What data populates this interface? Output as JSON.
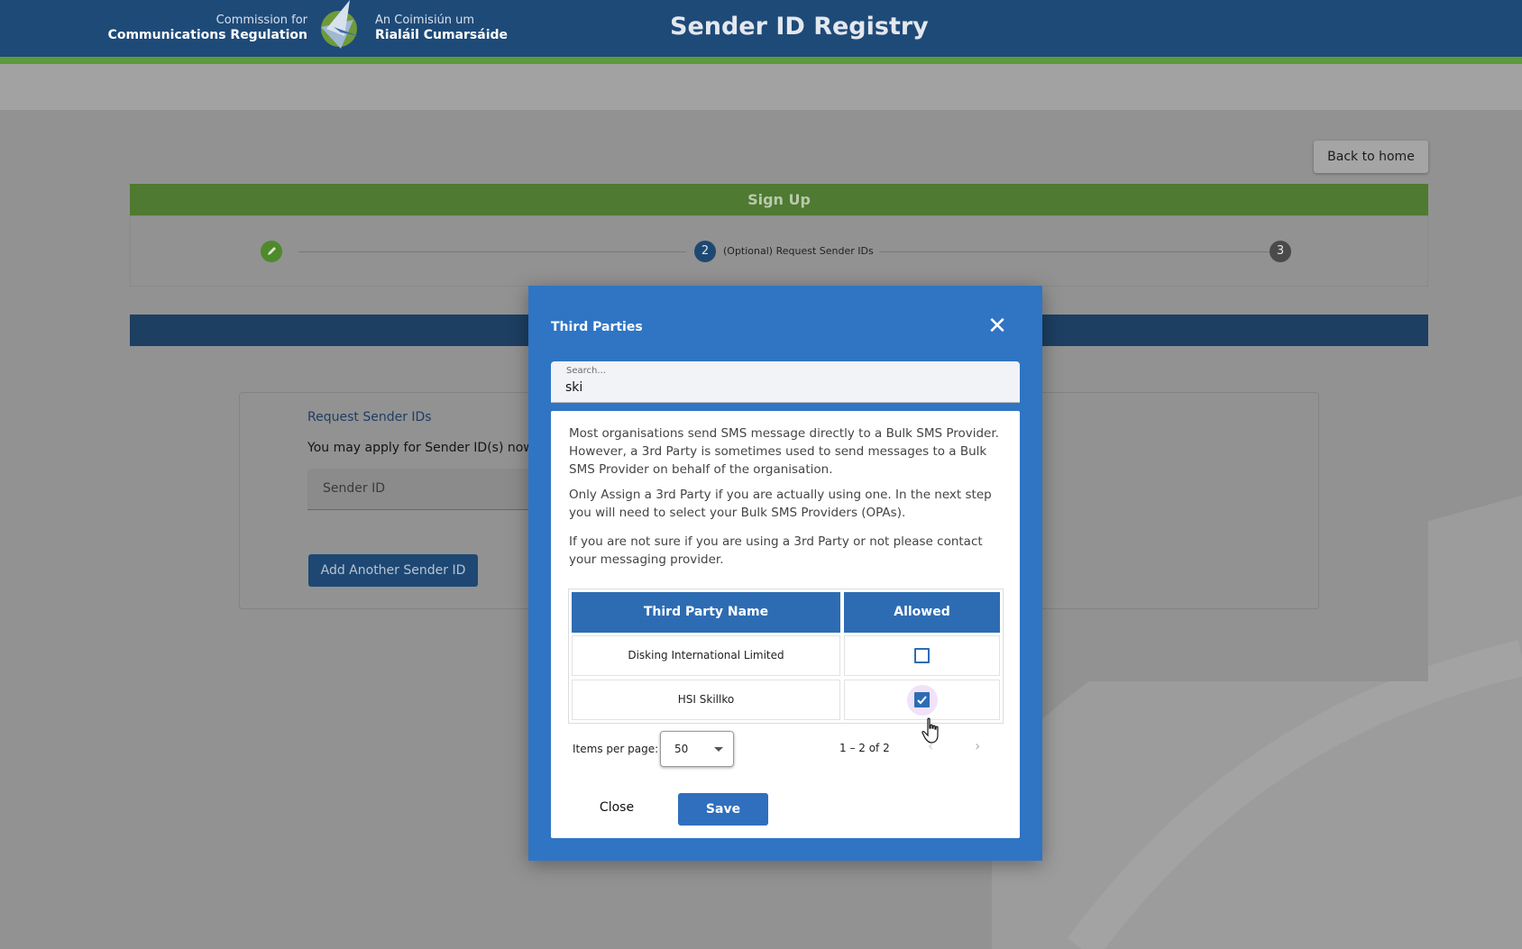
{
  "header": {
    "logo_left_line1": "Commission for",
    "logo_left_line2": "Communications Regulation",
    "logo_right_line1": "An Coimisiún um",
    "logo_right_line2": "Rialáil Cumarsáide",
    "app_title": "Sender ID Registry"
  },
  "page": {
    "back_button": "Back to home",
    "signup_title": "Sign Up",
    "steps": [
      {
        "number": "",
        "label": "",
        "state": "done"
      },
      {
        "number": "2",
        "label": "(Optional) Request Sender IDs",
        "state": "active"
      },
      {
        "number": "3",
        "label": "",
        "state": "pending"
      }
    ],
    "request_title": "Request Sender IDs",
    "request_text": "You may apply for Sender ID(s) now o",
    "sender_id_placeholder": "Sender ID",
    "add_button": "Add Another Sender ID"
  },
  "modal": {
    "title": "Third Parties",
    "close_icon": "close-icon",
    "search": {
      "label": "Search...",
      "value": "ski"
    },
    "paragraphs": [
      "Most organisations send SMS message directly to a Bulk SMS Provider. However, a 3rd Party is sometimes used to send messages to a Bulk SMS Provider on behalf of the organisation.",
      "Only Assign a 3rd Party if you are actually using one. In the next step you will need to select your Bulk SMS Providers (OPAs).",
      "If you are not sure if you are using a 3rd Party or not please contact your messaging provider."
    ],
    "table": {
      "headers": [
        "Third Party Name",
        "Allowed"
      ],
      "rows": [
        {
          "name": "Disking International Limited",
          "allowed": false
        },
        {
          "name": "HSI Skillko",
          "allowed": true
        }
      ]
    },
    "pager": {
      "label": "Items per page:",
      "page_size": "50",
      "range": "1 – 2 of 2"
    },
    "close_button": "Close",
    "save_button": "Save"
  },
  "colors": {
    "header_bg": "#1e4a78",
    "accent_green": "#5d9a3a",
    "modal_blue": "#2f75c4",
    "table_header": "#2d6cb3"
  }
}
